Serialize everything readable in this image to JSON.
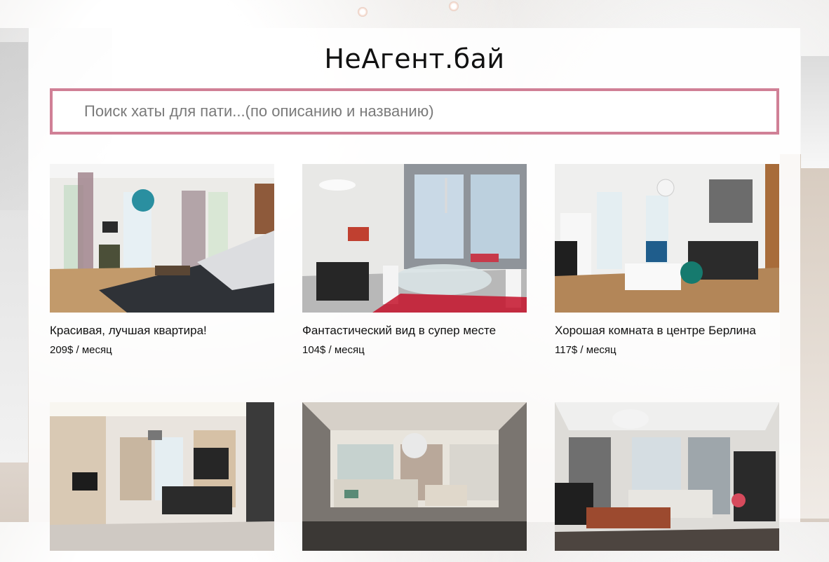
{
  "site": {
    "title": "НеАгент.бай"
  },
  "search": {
    "placeholder": "Поиск хаты для пати...(по описанию и названию)"
  },
  "listings": [
    {
      "name": "Красивая, лучшая квартира!",
      "price": "209$ / месяц"
    },
    {
      "name": "Фантастический вид в супер месте",
      "price": "104$ / месяц"
    },
    {
      "name": "Хорошая комната в центре Берлина",
      "price": "117$ / месяц"
    },
    {
      "name": "",
      "price": ""
    },
    {
      "name": "",
      "price": ""
    },
    {
      "name": "",
      "price": ""
    }
  ],
  "colors": {
    "search_border": "#d08096",
    "panel_bg": "#ffffff",
    "text": "#111111"
  }
}
